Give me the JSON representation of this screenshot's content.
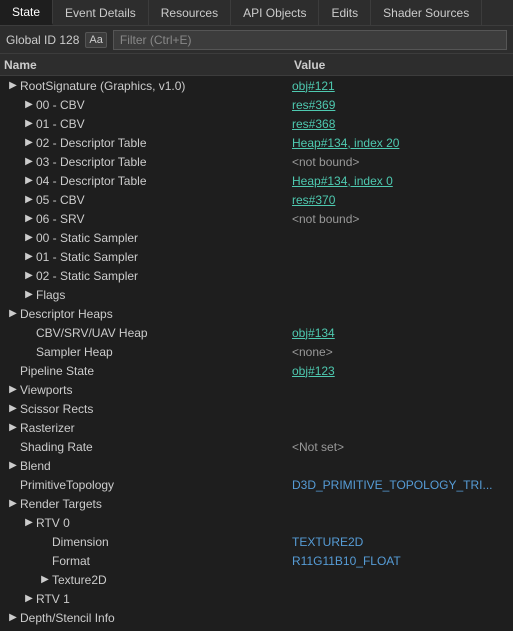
{
  "tabs": [
    {
      "label": "State",
      "active": true
    },
    {
      "label": "Event Details",
      "active": false
    },
    {
      "label": "Resources",
      "active": false
    },
    {
      "label": "API Objects",
      "active": false
    },
    {
      "label": "Edits",
      "active": false
    },
    {
      "label": "Shader Sources",
      "active": false
    }
  ],
  "toolbar": {
    "global_id_label": "Global ID 128",
    "aa_label": "Aa",
    "filter_placeholder": "Filter (Ctrl+E)"
  },
  "columns": {
    "name": "Name",
    "value": "Value"
  },
  "rows": [
    {
      "indent": 0,
      "toggle": "expand",
      "name": "RootSignature (Graphics, v1.0)",
      "value": "obj#121",
      "value_type": "link"
    },
    {
      "indent": 1,
      "toggle": "expand",
      "name": "00 - CBV",
      "value": "res#369",
      "value_type": "link"
    },
    {
      "indent": 1,
      "toggle": "expand",
      "name": "01 - CBV",
      "value": "res#368",
      "value_type": "link"
    },
    {
      "indent": 1,
      "toggle": "expand",
      "name": "02 - Descriptor Table",
      "value": "Heap#134, index 20",
      "value_type": "link"
    },
    {
      "indent": 1,
      "toggle": "expand",
      "name": "03 - Descriptor Table",
      "value": "<not bound>",
      "value_type": "gray"
    },
    {
      "indent": 1,
      "toggle": "expand",
      "name": "04 - Descriptor Table",
      "value": "Heap#134, index 0",
      "value_type": "link"
    },
    {
      "indent": 1,
      "toggle": "expand",
      "name": "05 - CBV",
      "value": "res#370",
      "value_type": "link"
    },
    {
      "indent": 1,
      "toggle": "expand",
      "name": "06 - SRV",
      "value": "<not bound>",
      "value_type": "gray"
    },
    {
      "indent": 1,
      "toggle": "expand",
      "name": "00 - Static Sampler",
      "value": "",
      "value_type": ""
    },
    {
      "indent": 1,
      "toggle": "expand",
      "name": "01 - Static Sampler",
      "value": "",
      "value_type": ""
    },
    {
      "indent": 1,
      "toggle": "expand",
      "name": "02 - Static Sampler",
      "value": "",
      "value_type": ""
    },
    {
      "indent": 1,
      "toggle": "expand",
      "name": "Flags",
      "value": "",
      "value_type": ""
    },
    {
      "indent": 0,
      "toggle": "expand",
      "name": "Descriptor Heaps",
      "value": "",
      "value_type": ""
    },
    {
      "indent": 1,
      "toggle": "none",
      "name": "CBV/SRV/UAV Heap",
      "value": "obj#134",
      "value_type": "link"
    },
    {
      "indent": 1,
      "toggle": "none",
      "name": "Sampler Heap",
      "value": "<none>",
      "value_type": "gray"
    },
    {
      "indent": 0,
      "toggle": "none",
      "name": "Pipeline State",
      "value": "obj#123",
      "value_type": "link"
    },
    {
      "indent": 0,
      "toggle": "expand",
      "name": "Viewports",
      "value": "",
      "value_type": ""
    },
    {
      "indent": 0,
      "toggle": "expand",
      "name": "Scissor Rects",
      "value": "",
      "value_type": ""
    },
    {
      "indent": 0,
      "toggle": "expand",
      "name": "Rasterizer",
      "value": "",
      "value_type": ""
    },
    {
      "indent": 0,
      "toggle": "none",
      "name": "Shading Rate",
      "value": "<Not set>",
      "value_type": "gray"
    },
    {
      "indent": 0,
      "toggle": "expand",
      "name": "Blend",
      "value": "",
      "value_type": ""
    },
    {
      "indent": 0,
      "toggle": "none",
      "name": "PrimitiveTopology",
      "value": "D3D_PRIMITIVE_TOPOLOGY_TRI...",
      "value_type": "blue"
    },
    {
      "indent": 0,
      "toggle": "expand",
      "name": "Render Targets",
      "value": "",
      "value_type": ""
    },
    {
      "indent": 1,
      "toggle": "expand",
      "name": "RTV 0",
      "value": "",
      "value_type": ""
    },
    {
      "indent": 2,
      "toggle": "none",
      "name": "Dimension",
      "value": "TEXTURE2D",
      "value_type": "blue"
    },
    {
      "indent": 2,
      "toggle": "none",
      "name": "Format",
      "value": "R11G11B10_FLOAT",
      "value_type": "blue"
    },
    {
      "indent": 2,
      "toggle": "expand",
      "name": "Texture2D",
      "value": "",
      "value_type": ""
    },
    {
      "indent": 1,
      "toggle": "expand",
      "name": "RTV 1",
      "value": "",
      "value_type": ""
    },
    {
      "indent": 0,
      "toggle": "expand",
      "name": "Depth/Stencil Info",
      "value": "",
      "value_type": ""
    }
  ]
}
